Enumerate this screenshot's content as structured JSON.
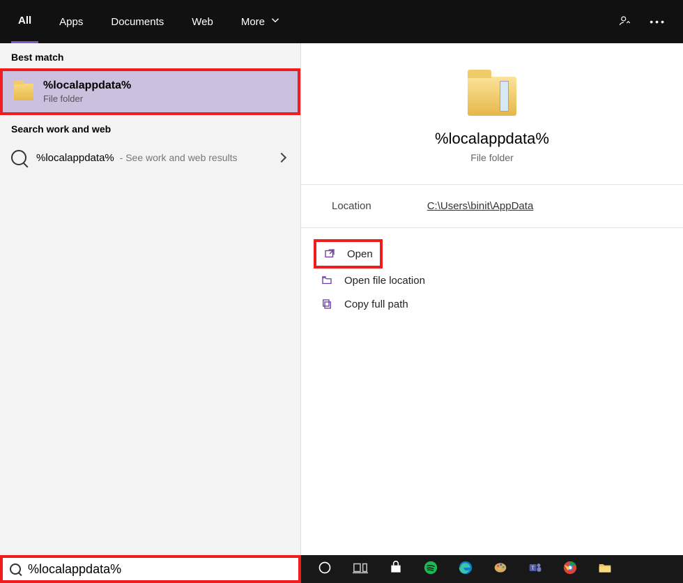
{
  "topbar": {
    "tabs": {
      "all": "All",
      "apps": "Apps",
      "documents": "Documents",
      "web": "Web",
      "more": "More"
    }
  },
  "left": {
    "bestmatch_label": "Best match",
    "bestmatch": {
      "title": "%localappdata%",
      "subtitle": "File folder"
    },
    "searchweb_label": "Search work and web",
    "searchweb": {
      "query": "%localappdata%",
      "desc": "- See work and web results"
    }
  },
  "preview": {
    "title": "%localappdata%",
    "subtitle": "File folder",
    "location_label": "Location",
    "location_value": "C:\\Users\\binit\\AppData",
    "actions": {
      "open": "Open",
      "open_location": "Open file location",
      "copy_path": "Copy full path"
    }
  },
  "search": {
    "value": "%localappdata%"
  }
}
